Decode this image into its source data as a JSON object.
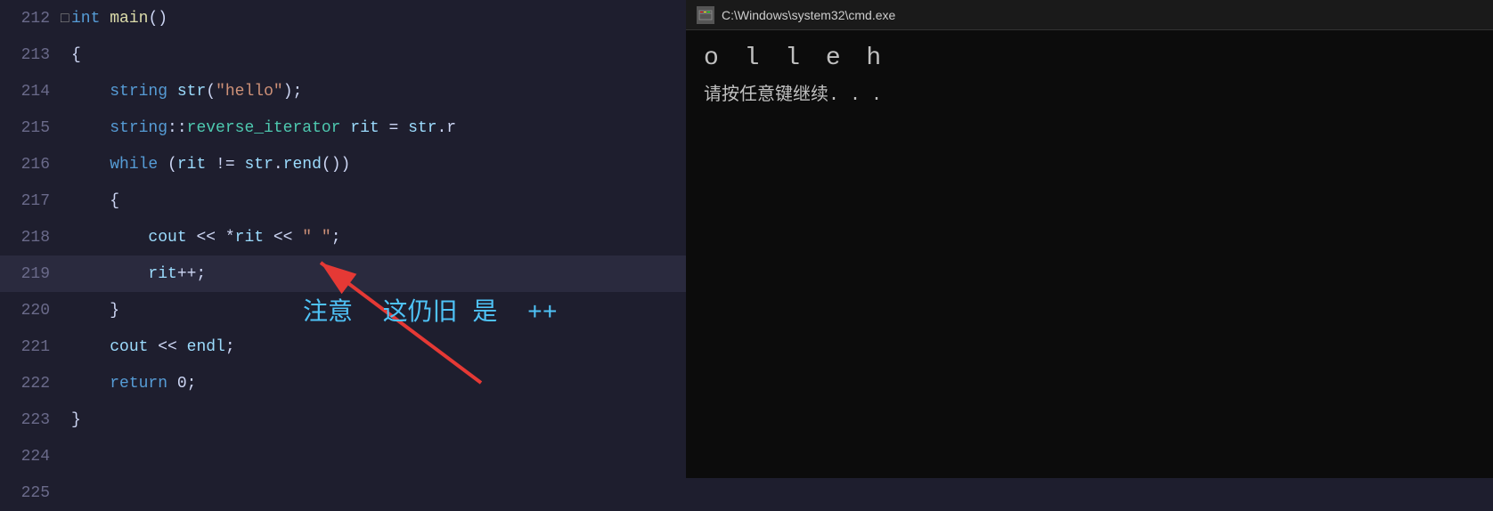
{
  "editor": {
    "lines": [
      {
        "number": "212",
        "indicator": "□",
        "indicatorActive": false,
        "content": [
          {
            "text": "int ",
            "class": "kw"
          },
          {
            "text": "main",
            "class": "fn"
          },
          {
            "text": "()",
            "class": "plain"
          }
        ]
      },
      {
        "number": "213",
        "indicator": " ",
        "indicatorActive": false,
        "content": [
          {
            "text": "{",
            "class": "plain"
          }
        ]
      },
      {
        "number": "214",
        "indicator": " ",
        "indicatorActive": false,
        "content": [
          {
            "text": "    string ",
            "class": "kw"
          },
          {
            "text": "str",
            "class": "varname"
          },
          {
            "text": "(",
            "class": "plain"
          },
          {
            "text": "\"hello\"",
            "class": "str"
          },
          {
            "text": ");",
            "class": "plain"
          }
        ]
      },
      {
        "number": "215",
        "indicator": " ",
        "indicatorActive": false,
        "content": [
          {
            "text": "    string::",
            "class": "kw"
          },
          {
            "text": "reverse_iterator ",
            "class": "type"
          },
          {
            "text": "rit = str.r",
            "class": "plain"
          }
        ]
      },
      {
        "number": "216",
        "indicator": " ",
        "indicatorActive": false,
        "content": [
          {
            "text": "    while",
            "class": "kw"
          },
          {
            "text": " (rit != str.",
            "class": "plain"
          },
          {
            "text": "rend",
            "class": "method"
          },
          {
            "text": "())",
            "class": "plain"
          }
        ]
      },
      {
        "number": "217",
        "indicator": " ",
        "indicatorActive": false,
        "content": [
          {
            "text": "    {",
            "class": "plain"
          }
        ]
      },
      {
        "number": "218",
        "indicator": " ",
        "indicatorActive": false,
        "content": [
          {
            "text": "        cout",
            "class": "varname"
          },
          {
            "text": " << *rit << ",
            "class": "plain"
          },
          {
            "text": "\" \"",
            "class": "str"
          },
          {
            "text": ";",
            "class": "plain"
          }
        ]
      },
      {
        "number": "219",
        "indicator": " ",
        "indicatorActive": true,
        "highlighted": true,
        "content": [
          {
            "text": "        rit++;",
            "class": "plain"
          }
        ]
      },
      {
        "number": "220",
        "indicator": " ",
        "indicatorActive": false,
        "content": [
          {
            "text": "    }",
            "class": "plain"
          }
        ]
      },
      {
        "number": "221",
        "indicator": " ",
        "indicatorActive": false,
        "content": [
          {
            "text": "    cout",
            "class": "varname"
          },
          {
            "text": " << endl;",
            "class": "plain"
          }
        ]
      },
      {
        "number": "222",
        "indicator": " ",
        "indicatorActive": false,
        "content": [
          {
            "text": "    return ",
            "class": "kw"
          },
          {
            "text": "0;",
            "class": "plain"
          }
        ]
      },
      {
        "number": "223",
        "indicator": " ",
        "indicatorActive": false,
        "content": [
          {
            "text": "}",
            "class": "plain"
          }
        ]
      },
      {
        "number": "224",
        "indicator": " ",
        "indicatorActive": false,
        "content": []
      },
      {
        "number": "225",
        "indicator": " ",
        "indicatorActive": false,
        "content": []
      }
    ]
  },
  "cmd": {
    "title": "C:\\Windows\\system32\\cmd.exe",
    "output_large": "o l l e h",
    "prompt_text": "请按任意键继续. . ."
  },
  "annotation": {
    "text": "注意  这仍旧 是  ++"
  },
  "arrow": {
    "color": "#e53935"
  }
}
